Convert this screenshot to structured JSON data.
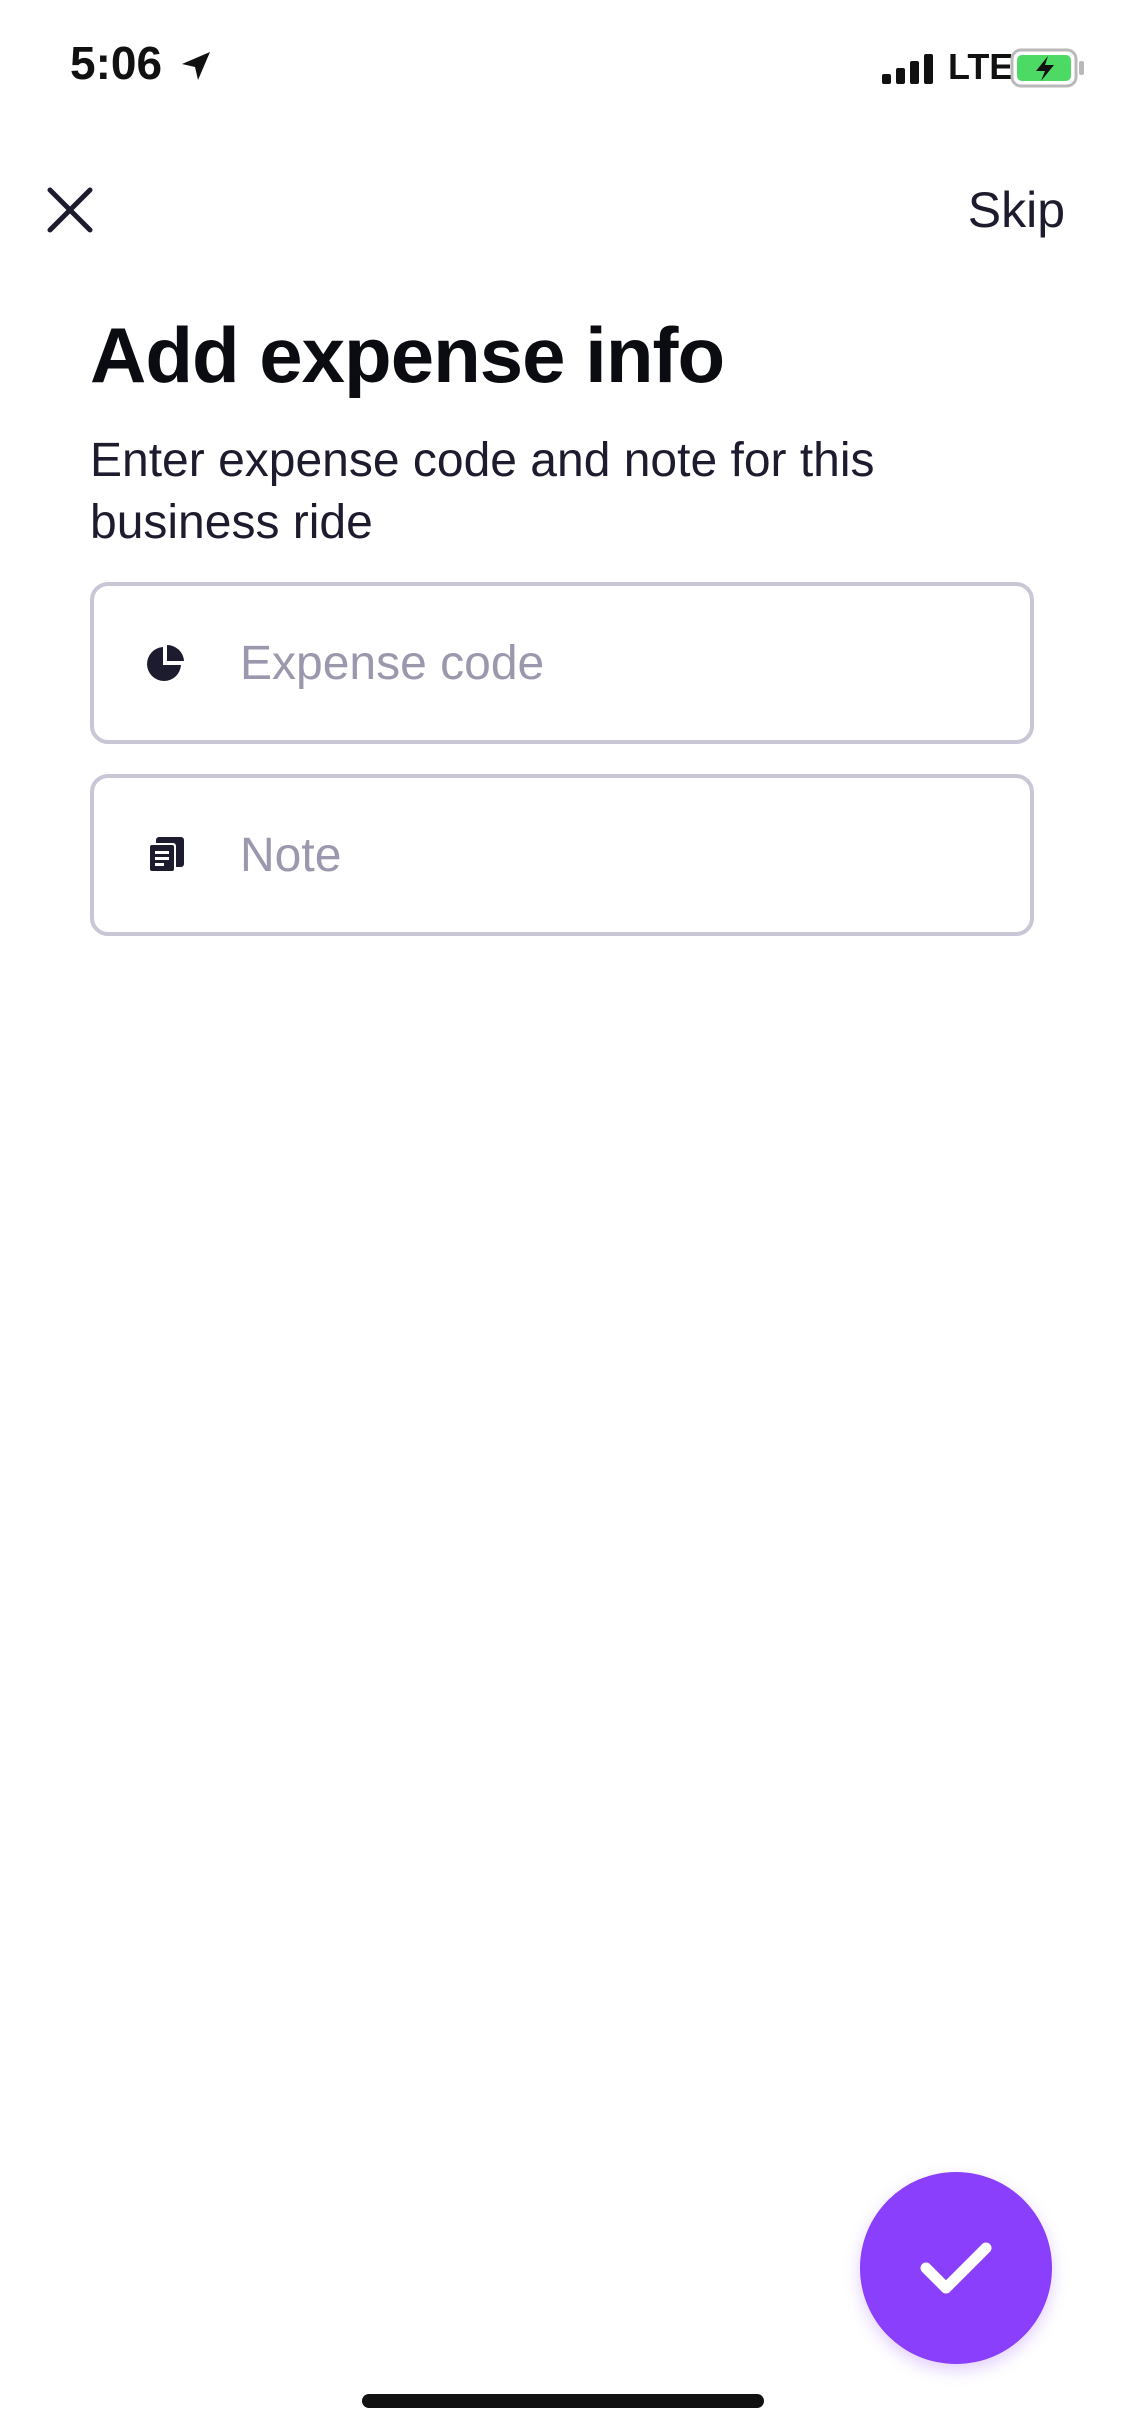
{
  "status_bar": {
    "time": "5:06",
    "network": "LTE",
    "icons": {
      "location": "location-arrow-icon",
      "signal": "cellular-signal-icon",
      "battery": "battery-charging-icon"
    },
    "battery_color": "#4cd964"
  },
  "nav": {
    "close_icon": "close-icon",
    "skip_label": "Skip"
  },
  "header": {
    "title": "Add expense info",
    "subtitle": "Enter expense code and note for this business ride"
  },
  "form": {
    "expense_code": {
      "icon": "pie-chart-icon",
      "placeholder": "Expense code",
      "value": ""
    },
    "note": {
      "icon": "note-icon",
      "placeholder": "Note",
      "value": ""
    }
  },
  "actions": {
    "confirm_icon": "checkmark-icon",
    "accent_color": "#8a3ffc"
  }
}
